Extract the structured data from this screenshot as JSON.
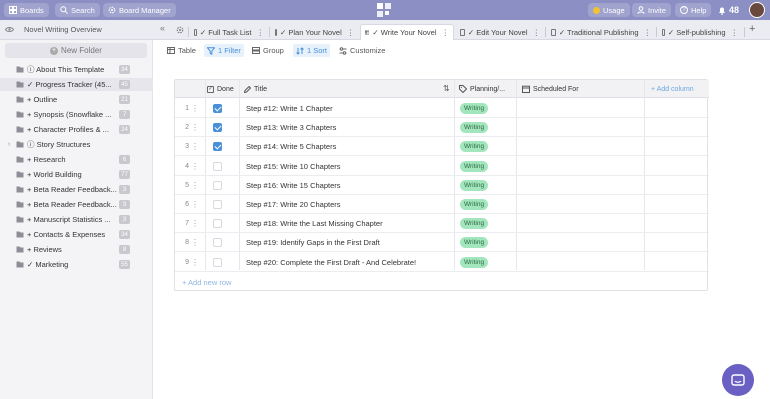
{
  "topbar": {
    "boards_label": "Boards",
    "search_label": "Search",
    "board_manager_label": "Board Manager",
    "usage_label": "Usage",
    "invite_label": "Invite",
    "help_label": "Help",
    "notifications_count": "48",
    "brand_color": "#8b8fc4"
  },
  "sidebar": {
    "title": "Novel Writing Overview",
    "new_folder_label": "New Folder",
    "items": [
      {
        "label": "ⓘ About This Template",
        "count": "34",
        "icon": "folder-icon"
      },
      {
        "label": "✓ Progress Tracker (45...",
        "count": "45",
        "icon": "folder-icon",
        "selected": true
      },
      {
        "label": "+ Outline",
        "count": "21",
        "icon": "folder-icon"
      },
      {
        "label": "+ Synopsis (Snowflake ...",
        "count": "7",
        "icon": "folder-icon"
      },
      {
        "label": "+ Character Profiles & ...",
        "count": "24",
        "icon": "folder-icon"
      },
      {
        "label": "ⓘ Story Structures",
        "count": "",
        "icon": "folder-icon",
        "expandable": true
      },
      {
        "label": "+ Research",
        "count": "6",
        "icon": "folder-icon"
      },
      {
        "label": "+ World Building",
        "count": "77",
        "icon": "folder-icon"
      },
      {
        "label": "+ Beta Reader Feedback...",
        "count": "3",
        "icon": "folder-icon"
      },
      {
        "label": "+ Beta Reader Feedback...",
        "count": "3",
        "icon": "folder-icon"
      },
      {
        "label": "+ Manuscript Statistics ...",
        "count": "3",
        "icon": "folder-icon"
      },
      {
        "label": "+ Contacts & Expenses",
        "count": "34",
        "icon": "folder-icon"
      },
      {
        "label": "+ Reviews",
        "count": "8",
        "icon": "folder-icon"
      },
      {
        "label": "✓ Marketing",
        "count": "55",
        "icon": "folder-icon"
      }
    ]
  },
  "tabs": [
    {
      "label": "✓ Full Task List",
      "active": false
    },
    {
      "label": "✓ Plan Your Novel",
      "active": false
    },
    {
      "label": "✓ Write Your Novel",
      "active": true
    },
    {
      "label": "✓ Edit Your Novel",
      "active": false
    },
    {
      "label": "✓ Traditional Publishing",
      "active": false
    },
    {
      "label": "✓ Self-publishing",
      "active": false
    }
  ],
  "toolbar": {
    "table_label": "Table",
    "filter_label": "1 Filter",
    "group_label": "Group",
    "sort_label": "1 Sort",
    "customize_label": "Customize"
  },
  "table": {
    "columns": {
      "done": "Done",
      "title": "Title",
      "planning": "Planning/...",
      "scheduled": "Scheduled For",
      "add_column": "+ Add column"
    },
    "rows": [
      {
        "n": "1",
        "done": true,
        "title": "Step #12: Write 1 Chapter",
        "status": "Writing"
      },
      {
        "n": "2",
        "done": true,
        "title": "Step #13: Write 3 Chapters",
        "status": "Writing"
      },
      {
        "n": "3",
        "done": true,
        "title": "Step #14: Write 5 Chapters",
        "status": "Writing"
      },
      {
        "n": "4",
        "done": false,
        "title": "Step #15: Write 10 Chapters",
        "status": "Writing"
      },
      {
        "n": "5",
        "done": false,
        "title": "Step #16: Write 15 Chapters",
        "status": "Writing"
      },
      {
        "n": "6",
        "done": false,
        "title": "Step #17: Write 20 Chapters",
        "status": "Writing"
      },
      {
        "n": "7",
        "done": false,
        "title": "Step #18: Write the Last Missing Chapter",
        "status": "Writing"
      },
      {
        "n": "8",
        "done": false,
        "title": "Step #19: Identify Gaps in the First Draft",
        "status": "Writing"
      },
      {
        "n": "9",
        "done": false,
        "title": "Step #20: Complete the First Draft - And Celebrate!",
        "status": "Writing"
      }
    ],
    "add_row_label": "+ Add new row",
    "status_color": "#a3e5bd",
    "checkbox_color": "#4a90d9"
  }
}
